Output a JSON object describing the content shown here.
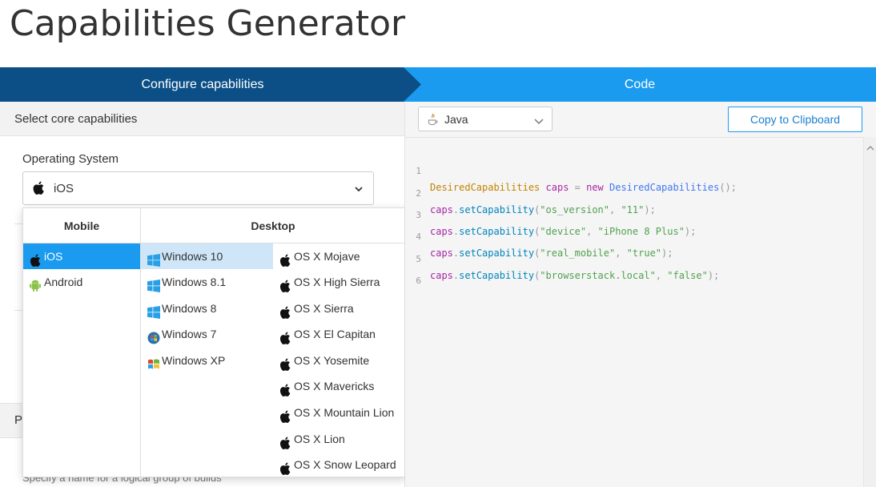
{
  "page": {
    "title": "Capabilities Generator"
  },
  "stepper": {
    "configure_label": "Configure capabilities",
    "code_label": "Code"
  },
  "left": {
    "section_label": "Select core capabilities",
    "os_label": "Operating System",
    "os_value": "iOS",
    "ghost_section_label": "Pr",
    "ghost_description": "Specify a name for a logical group of builds"
  },
  "dropdown": {
    "mobile_header": "Mobile",
    "desktop_header": "Desktop",
    "mobile_options": [
      "iOS",
      "Android"
    ],
    "windows_options": [
      "Windows 10",
      "Windows 8.1",
      "Windows 8",
      "Windows 7",
      "Windows XP"
    ],
    "mac_options": [
      "OS X Mojave",
      "OS X High Sierra",
      "OS X Sierra",
      "OS X El Capitan",
      "OS X Yosemite",
      "OS X Mavericks",
      "OS X Mountain Lion",
      "OS X Lion",
      "OS X Snow Leopard"
    ]
  },
  "right": {
    "language": "Java",
    "copy_label": "Copy to Clipboard",
    "line_numbers": [
      "1",
      "2",
      "3",
      "4",
      "5",
      "6"
    ],
    "code": {
      "l1_type": "DesiredCapabilities",
      "l1_var": "caps",
      "l1_eq": " = ",
      "l1_new": "new",
      "l1_cls": "DesiredCapabilities",
      "l1_end": "();",
      "var": "caps",
      "dot": ".",
      "fn": "setCapability",
      "open": "(",
      "sep": ", ",
      "close": ");",
      "l2_key": "\"os_version\"",
      "l2_val": "\"11\"",
      "l3_key": "\"device\"",
      "l3_val": "\"iPhone 8 Plus\"",
      "l4_key": "\"real_mobile\"",
      "l4_val": "\"true\"",
      "l5_key": "\"browserstack.local\"",
      "l5_val": "\"false\""
    }
  },
  "colors": {
    "dark_step": "#0b4f86",
    "light_step": "#1a9bf0",
    "selected": "#1a9bf0",
    "selected_light": "#cfe6f8"
  }
}
